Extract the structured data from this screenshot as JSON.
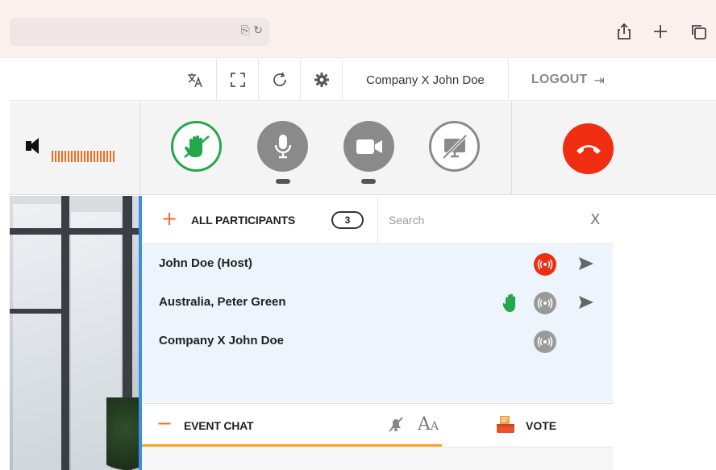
{
  "topbar": {
    "user": "Company X John Doe",
    "logout": "LOGOUT"
  },
  "controls": {
    "raise_hand_color": "#22a84a",
    "end_call_color": "#ef2d10"
  },
  "participants": {
    "title": "ALL PARTICIPANTS",
    "count": "3",
    "search_placeholder": "Search",
    "close": "X",
    "items": [
      {
        "name": "John Doe (Host)",
        "audio": "active",
        "hand": false
      },
      {
        "name": "Australia, Peter Green",
        "audio": "idle",
        "hand": true
      },
      {
        "name": "Company X John Doe",
        "audio": "idle",
        "hand": false
      }
    ]
  },
  "chat": {
    "title": "EVENT CHAT",
    "font_size_label": "A",
    "font_size_small": "A",
    "vote_label": "VOTE"
  },
  "colors": {
    "accent": "#f26a22",
    "panel_border": "#3d8fe0",
    "list_bg": "#edf4fb",
    "chat_underline": "#f5a623"
  }
}
